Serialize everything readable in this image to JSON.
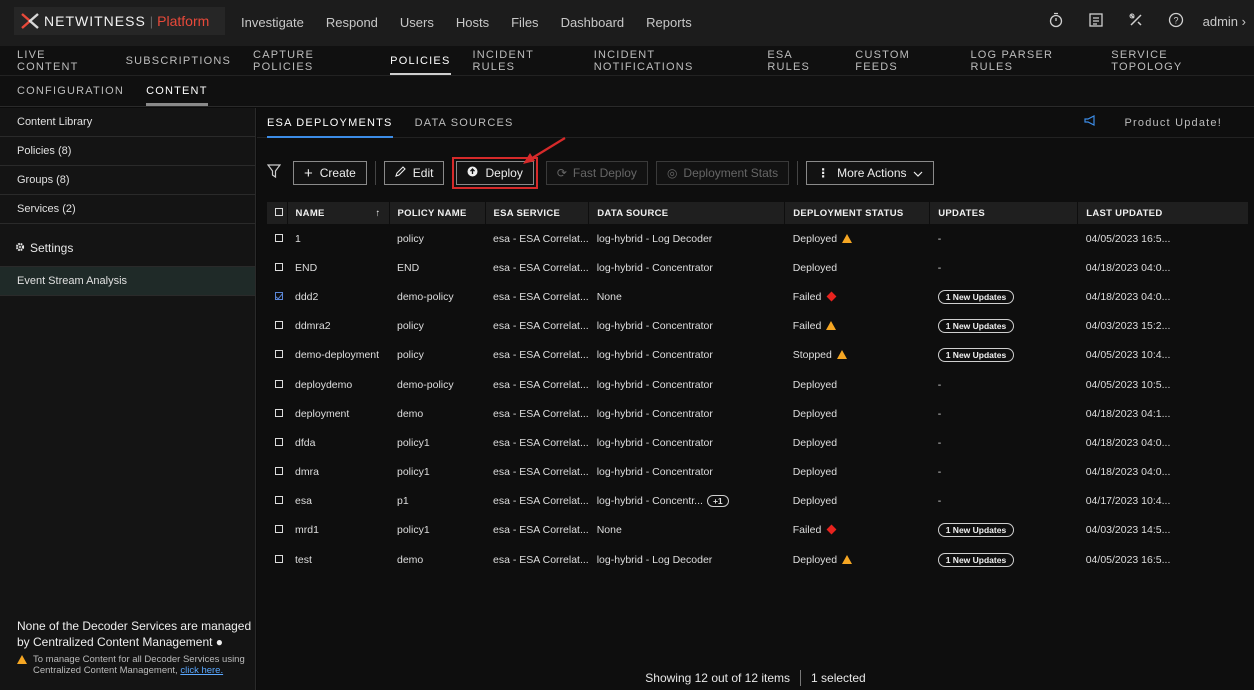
{
  "topbar": {
    "logo_text": "NETWITNESS",
    "logo_sub": "Platform",
    "nav": [
      "Investigate",
      "Respond",
      "Users",
      "Hosts",
      "Files",
      "Dashboard",
      "Reports"
    ],
    "user": "admin",
    "icons": [
      "timer-icon",
      "tasks-icon",
      "tools-icon",
      "help-icon"
    ]
  },
  "nav2": [
    "LIVE CONTENT",
    "SUBSCRIPTIONS",
    "CAPTURE POLICIES",
    "POLICIES",
    "INCIDENT RULES",
    "INCIDENT NOTIFICATIONS",
    "ESA RULES",
    "CUSTOM FEEDS",
    "LOG PARSER RULES",
    "SERVICE TOPOLOGY"
  ],
  "nav3": [
    "CONFIGURATION",
    "CONTENT"
  ],
  "sidebar": {
    "items": [
      "Content Library",
      "Policies (8)",
      "Groups (8)",
      "Services (2)"
    ],
    "settings_label": "Settings",
    "esa_label": "Event Stream Analysis",
    "note_heading": "None of the Decoder Services are managed by Centralized Content Management",
    "note_text": "To manage Content for all Decoder Services using Centralized Content Management,",
    "note_link": "click here."
  },
  "tabs": [
    "ESA DEPLOYMENTS",
    "DATA SOURCES"
  ],
  "product_update": "Product Update!",
  "toolbar": {
    "create": "Create",
    "edit": "Edit",
    "deploy": "Deploy",
    "fast_deploy": "Fast Deploy",
    "deployment_stats": "Deployment Stats",
    "more_actions": "More Actions"
  },
  "table": {
    "headers": [
      "NAME",
      "POLICY NAME",
      "ESA SERVICE",
      "DATA SOURCE",
      "DEPLOYMENT STATUS",
      "UPDATES",
      "LAST UPDATED"
    ],
    "rows": [
      {
        "name": "1",
        "policy": "policy",
        "esa": "esa - ESA Correlat...",
        "source": "log-hybrid - Log Decoder",
        "status": "Deployed",
        "status_icon": "warning",
        "updates": "-",
        "updated": "04/05/2023 16:5..."
      },
      {
        "name": "END",
        "policy": "END",
        "esa": "esa - ESA Correlat...",
        "source": "log-hybrid - Concentrator",
        "status": "Deployed",
        "status_icon": "",
        "updates": "-",
        "updated": "04/18/2023 04:0..."
      },
      {
        "name": "ddd2",
        "policy": "demo-policy",
        "esa": "esa - ESA Correlat...",
        "source": "None",
        "status": "Failed",
        "status_icon": "error",
        "updates": "1 New Updates",
        "updated": "04/18/2023 04:0...",
        "checked": true
      },
      {
        "name": "ddmra2",
        "policy": "policy",
        "esa": "esa - ESA Correlat...",
        "source": "log-hybrid - Concentrator",
        "status": "Failed",
        "status_icon": "warning",
        "updates": "1 New Updates",
        "updated": "04/03/2023 15:2..."
      },
      {
        "name": "demo-deployment",
        "policy": "policy",
        "esa": "esa - ESA Correlat...",
        "source": "log-hybrid - Concentrator",
        "status": "Stopped",
        "status_icon": "warning",
        "updates": "1 New Updates",
        "updated": "04/05/2023 10:4..."
      },
      {
        "name": "deploydemo",
        "policy": "demo-policy",
        "esa": "esa - ESA Correlat...",
        "source": "log-hybrid - Concentrator",
        "status": "Deployed",
        "status_icon": "",
        "updates": "-",
        "updated": "04/05/2023 10:5..."
      },
      {
        "name": "deployment",
        "policy": "demo",
        "esa": "esa - ESA Correlat...",
        "source": "log-hybrid - Concentrator",
        "status": "Deployed",
        "status_icon": "",
        "updates": "-",
        "updated": "04/18/2023 04:1..."
      },
      {
        "name": "dfda",
        "policy": "policy1",
        "esa": "esa - ESA Correlat...",
        "source": "log-hybrid - Concentrator",
        "status": "Deployed",
        "status_icon": "",
        "updates": "-",
        "updated": "04/18/2023 04:0..."
      },
      {
        "name": "dmra",
        "policy": "policy1",
        "esa": "esa - ESA Correlat...",
        "source": "log-hybrid - Concentrator",
        "status": "Deployed",
        "status_icon": "",
        "updates": "-",
        "updated": "04/18/2023 04:0..."
      },
      {
        "name": "esa",
        "policy": "p1",
        "esa": "esa - ESA Correlat...",
        "source": "log-hybrid - Concentr...",
        "source_more": "+1",
        "status": "Deployed",
        "status_icon": "",
        "updates": "-",
        "updated": "04/17/2023 10:4..."
      },
      {
        "name": "mrd1",
        "policy": "policy1",
        "esa": "esa - ESA Correlat...",
        "source": "None",
        "status": "Failed",
        "status_icon": "error",
        "updates": "1 New Updates",
        "updated": "04/03/2023 14:5..."
      },
      {
        "name": "test",
        "policy": "demo",
        "esa": "esa - ESA Correlat...",
        "source": "log-hybrid - Log Decoder",
        "status": "Deployed",
        "status_icon": "warning",
        "updates": "1 New Updates",
        "updated": "04/05/2023 16:5..."
      }
    ]
  },
  "footer": {
    "showing": "Showing 12 out of 12 items",
    "selected": "1 selected"
  },
  "colors": {
    "accent": "#3c8ce6",
    "warning": "#f5a623",
    "error": "#e8231e",
    "annotation": "#d62a2a"
  }
}
